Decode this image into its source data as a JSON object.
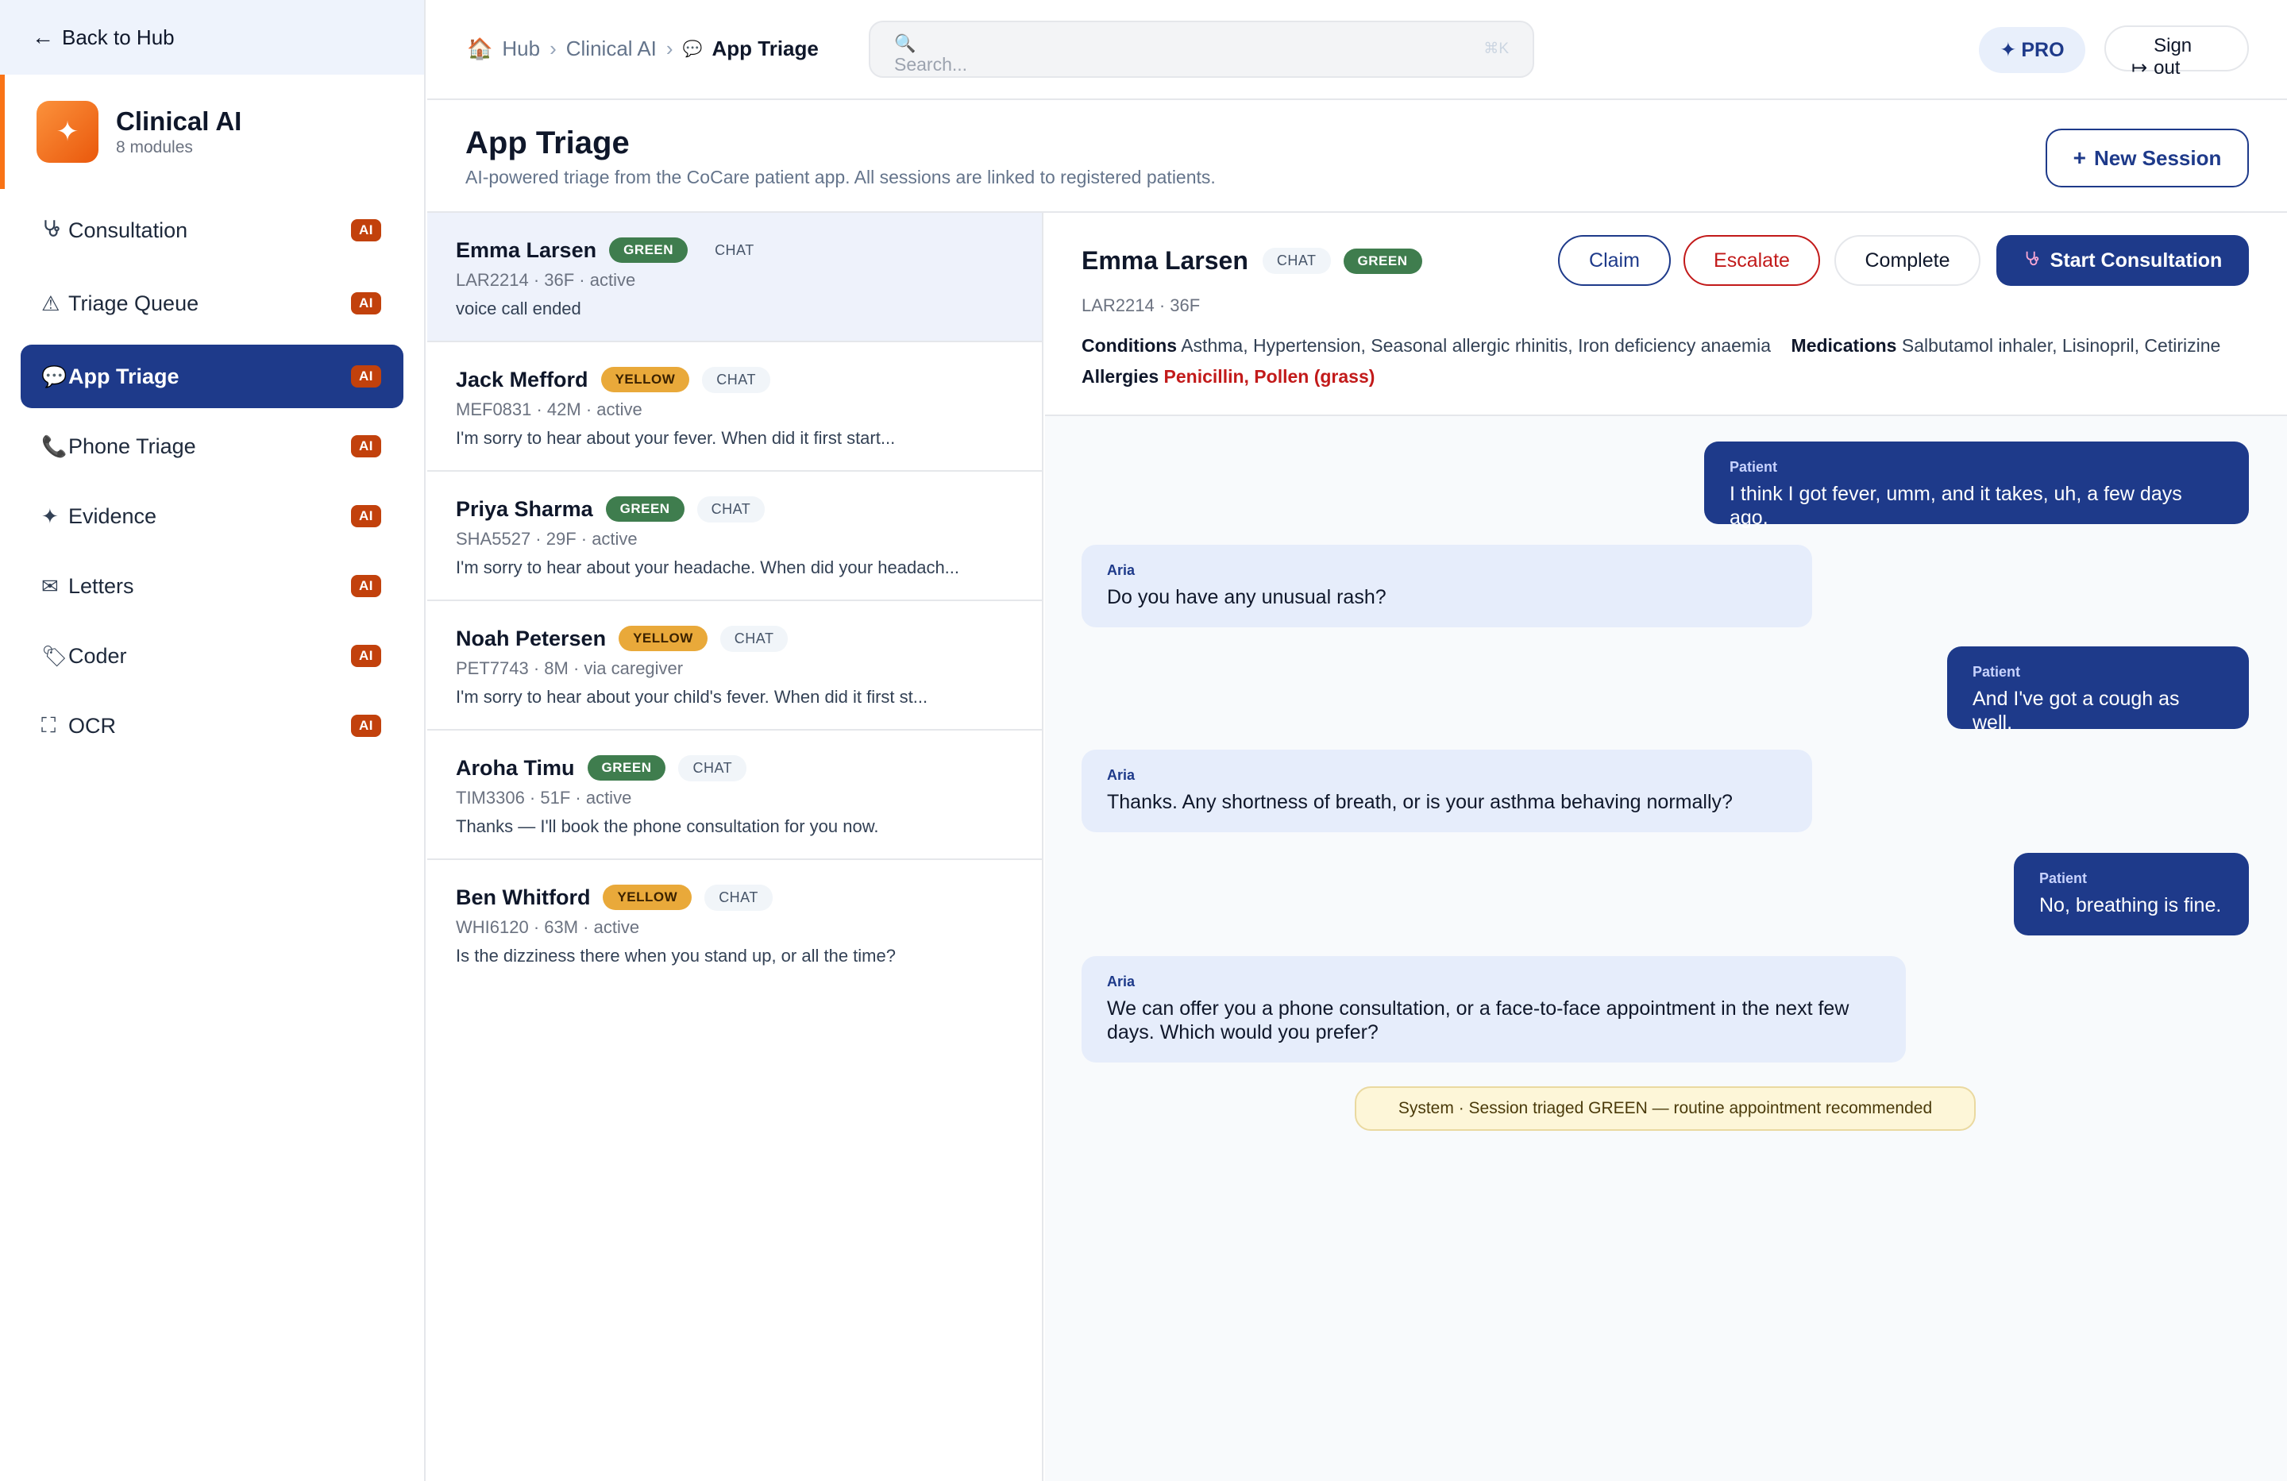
{
  "sidebar": {
    "back_label": "Back to Hub",
    "module": {
      "title": "Clinical AI",
      "subtitle": "8 modules",
      "icon": "sparkle-icon"
    },
    "badge_label": "AI",
    "items": [
      {
        "label": "Consultation",
        "icon": "stethoscope-icon"
      },
      {
        "label": "Triage Queue",
        "icon": "warning-triangle-icon"
      },
      {
        "label": "App Triage",
        "icon": "chat-bubble-icon"
      },
      {
        "label": "Phone Triage",
        "icon": "phone-icon"
      },
      {
        "label": "Evidence",
        "icon": "sparkle-icon"
      },
      {
        "label": "Letters",
        "icon": "envelope-icon"
      },
      {
        "label": "Coder",
        "icon": "tag-icon"
      },
      {
        "label": "OCR",
        "icon": "scan-frame-icon"
      }
    ]
  },
  "topbar": {
    "breadcrumb": [
      "Hub",
      "Clinical AI",
      "App Triage"
    ],
    "search_placeholder": "Search...",
    "search_shortcut": "⌘K",
    "pro_label": "PRO",
    "signout_label": "Sign out"
  },
  "page": {
    "title": "App Triage",
    "subtitle": "AI-powered triage from the CoCare patient app. All sessions are linked to registered patients.",
    "new_session_label": "New Session"
  },
  "sessions": [
    {
      "name": "Emma Larsen",
      "triage": "GREEN",
      "channel": "CHAT",
      "meta": "LAR2214 · 36F · active",
      "preview": "voice call ended"
    },
    {
      "name": "Jack Mefford",
      "triage": "YELLOW",
      "channel": "CHAT",
      "meta": "MEF0831 · 42M · active",
      "preview": "I'm sorry to hear about your fever. When did it first start..."
    },
    {
      "name": "Priya Sharma",
      "triage": "GREEN",
      "channel": "CHAT",
      "meta": "SHA5527 · 29F · active",
      "preview": "I'm sorry to hear about your headache. When did your headach..."
    },
    {
      "name": "Noah Petersen",
      "triage": "YELLOW",
      "channel": "CHAT",
      "meta": "PET7743 · 8M · via caregiver",
      "preview": "I'm sorry to hear about your child's fever. When did it first st..."
    },
    {
      "name": "Aroha Timu",
      "triage": "GREEN",
      "channel": "CHAT",
      "meta": "TIM3306 · 51F · active",
      "preview": "Thanks — I'll book the phone consultation for you now."
    },
    {
      "name": "Ben Whitford",
      "triage": "YELLOW",
      "channel": "CHAT",
      "meta": "WHI6120 · 63M · active",
      "preview": "Is the dizziness there when you stand up, or all the time?"
    }
  ],
  "detail": {
    "name": "Emma Larsen",
    "channel": "CHAT",
    "triage": "GREEN",
    "id_line": "LAR2214 · 36F",
    "conditions_label": "Conditions",
    "conditions": "Asthma, Hypertension, Seasonal allergic rhinitis, Iron deficiency anaemia",
    "medications_label": "Medications",
    "medications": "Salbutamol inhaler, Lisinopril, Cetirizine",
    "allergies_label": "Allergies",
    "allergies": "Penicillin, Pollen (grass)",
    "actions": {
      "claim": "Claim",
      "escalate": "Escalate",
      "complete": "Complete",
      "start": "Start Consultation"
    }
  },
  "messages": [
    {
      "sender": "Patient",
      "text": "I think I got fever, umm, and it takes, uh, a few days ago."
    },
    {
      "sender": "Aria",
      "text": "Do you have any unusual rash?"
    },
    {
      "sender": "Patient",
      "text": "And I've got a cough as well."
    },
    {
      "sender": "Aria",
      "text": "Thanks. Any shortness of breath, or is your asthma behaving normally?"
    },
    {
      "sender": "Patient",
      "text": "No, breathing is fine."
    },
    {
      "sender": "Aria",
      "text": "We can offer you a phone consultation, or a face-to-face appointment in the next few days. Which would you prefer?"
    }
  ],
  "system_message": "System · Session triaged GREEN — routine appointment recommended",
  "colors": {
    "primary": "#1e3a8a",
    "accent": "#f97316",
    "ai_badge": "#c2410c",
    "green": "#3f7d4e",
    "yellow": "#e9a93a",
    "danger": "#c21a1a"
  }
}
